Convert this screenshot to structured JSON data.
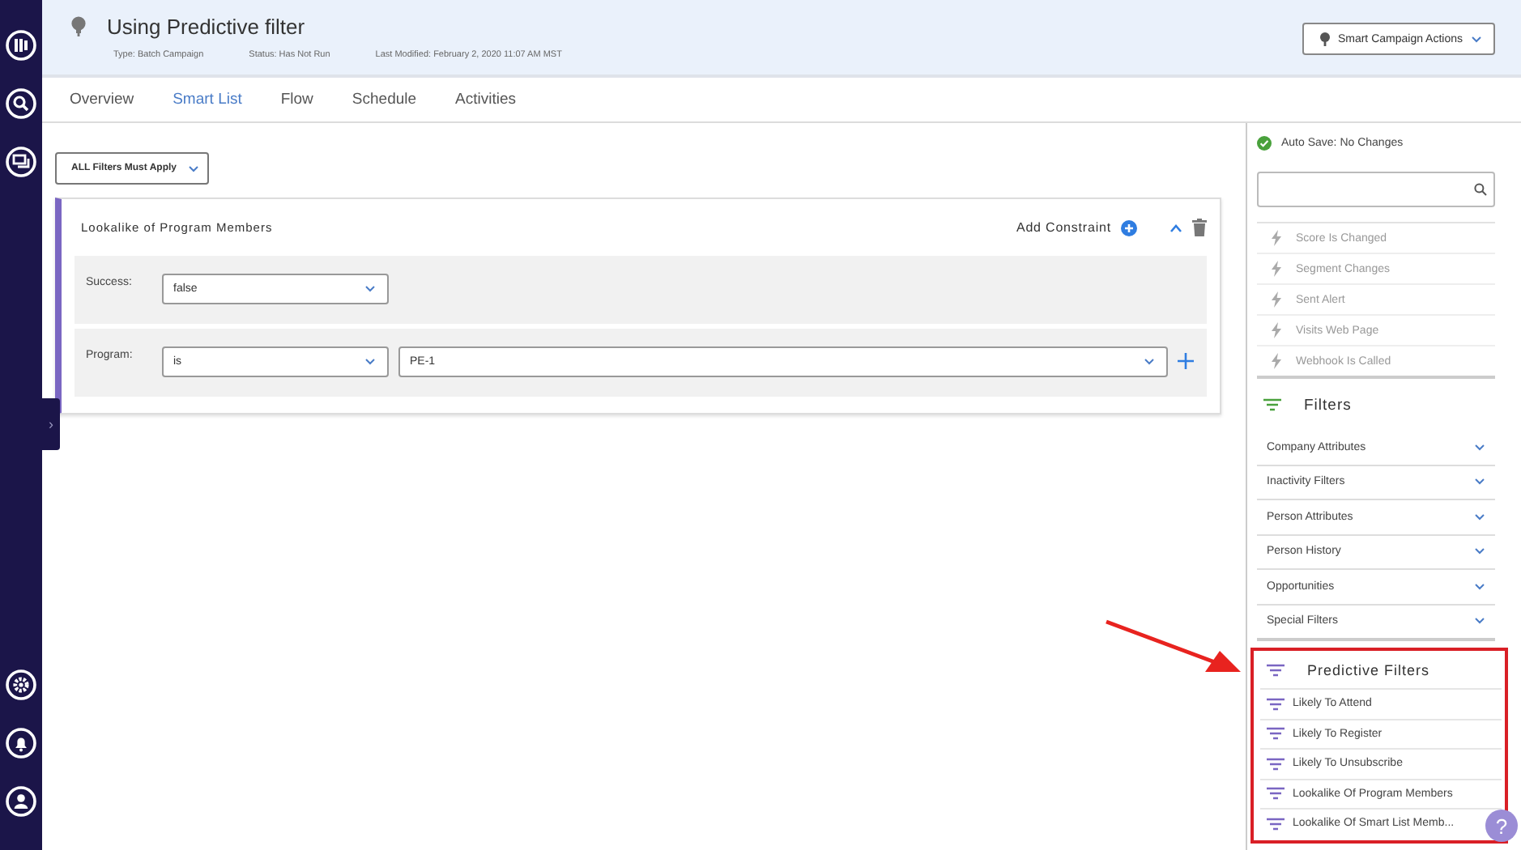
{
  "nav": {
    "expand_glyph": "›"
  },
  "header": {
    "title": "Using Predictive filter",
    "meta": [
      "Type: Batch Campaign",
      "Status: Has Not Run",
      "Last Modified: February 2, 2020 11:07 AM MST"
    ],
    "actions_button": "Smart Campaign Actions"
  },
  "tabs": [
    {
      "label": "Overview",
      "selected": false
    },
    {
      "label": "Smart List",
      "selected": true
    },
    {
      "label": "Flow",
      "selected": false
    },
    {
      "label": "Schedule",
      "selected": false
    },
    {
      "label": "Activities",
      "selected": false
    }
  ],
  "rule_select": "ALL Filters Must Apply",
  "filter": {
    "title": "Lookalike of Program Members",
    "add_constraint": "Add Constraint",
    "expanded": true,
    "rows": [
      {
        "label": "Success:",
        "fields": [
          "false"
        ],
        "can_add": false
      },
      {
        "label": "Program:",
        "fields": [
          "is",
          "PE-1"
        ],
        "can_add": true
      }
    ]
  },
  "side": {
    "autosave": "Auto Save: No Changes",
    "triggers": [
      "Score Is Changed",
      "Segment Changes",
      "Sent Alert",
      "Visits Web Page",
      "Webhook Is Called"
    ],
    "filters_heading": "Filters",
    "filter_groups": [
      "Company Attributes",
      "Inactivity Filters",
      "Person Attributes",
      "Person History",
      "Opportunities",
      "Special Filters"
    ],
    "predictive_heading": "Predictive Filters",
    "predictive_items": [
      "Likely To Attend",
      "Likely To Register",
      "Likely To Unsubscribe",
      "Lookalike Of Program Members",
      "Lookalike Of Smart List Memb..."
    ]
  },
  "help_glyph": "?"
}
